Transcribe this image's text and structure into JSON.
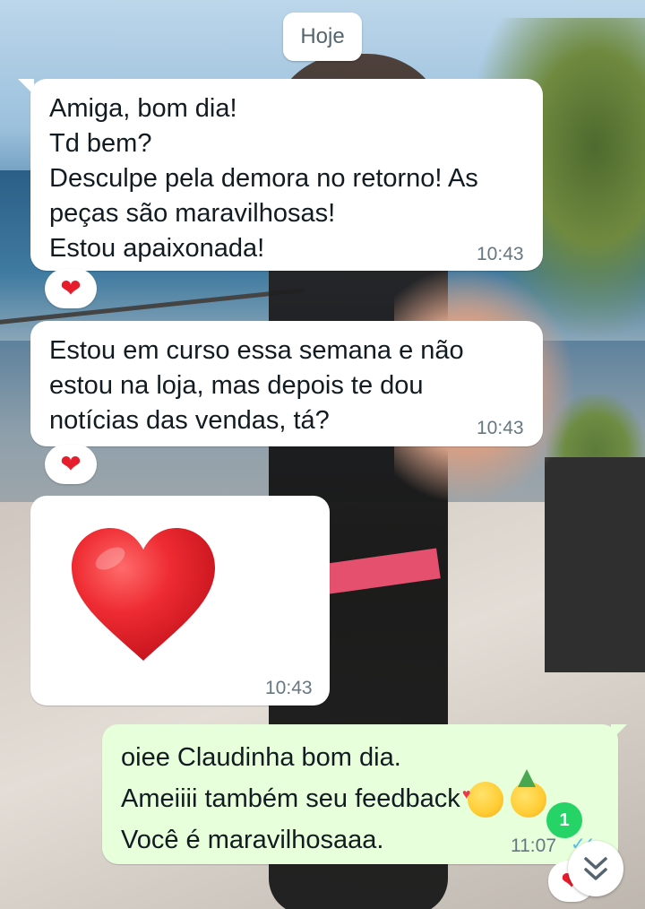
{
  "date_chip": "Hoje",
  "messages": [
    {
      "direction": "incoming",
      "text": "Amiga, bom dia!\nTd bem?\nDesculpe pela demora no retorno! As peças são maravilhosas!\nEstou apaixonada!",
      "time": "10:43",
      "reaction": "heart"
    },
    {
      "direction": "incoming",
      "text": "Estou em curso essa semana e não estou na loja, mas depois te dou notícias das vendas, tá?",
      "time": "10:43",
      "reaction": "heart"
    },
    {
      "direction": "incoming",
      "type": "emoji",
      "emoji": "red-heart",
      "time": "10:43"
    },
    {
      "direction": "outgoing",
      "line1": "oiee Claudinha bom dia.",
      "line2": "Ameiiii também seu feedback",
      "line3": "Você é maravilhosaaa.",
      "emojis": [
        "smiling-face-with-hearts",
        "partying-face"
      ],
      "time": "11:07",
      "status": "read",
      "reaction": "heart"
    }
  ],
  "unread_count": "1",
  "icons": {
    "scroll_down": "double-chevron-down-icon",
    "read_ticks": "double-check-icon",
    "reaction": "red-heart"
  },
  "colors": {
    "incoming_bubble": "#ffffff",
    "outgoing_bubble": "#e7ffdb",
    "timestamp": "#667781",
    "read_ticks": "#53bdeb",
    "unread_badge": "#25d366",
    "heart": "#e51d2d"
  }
}
